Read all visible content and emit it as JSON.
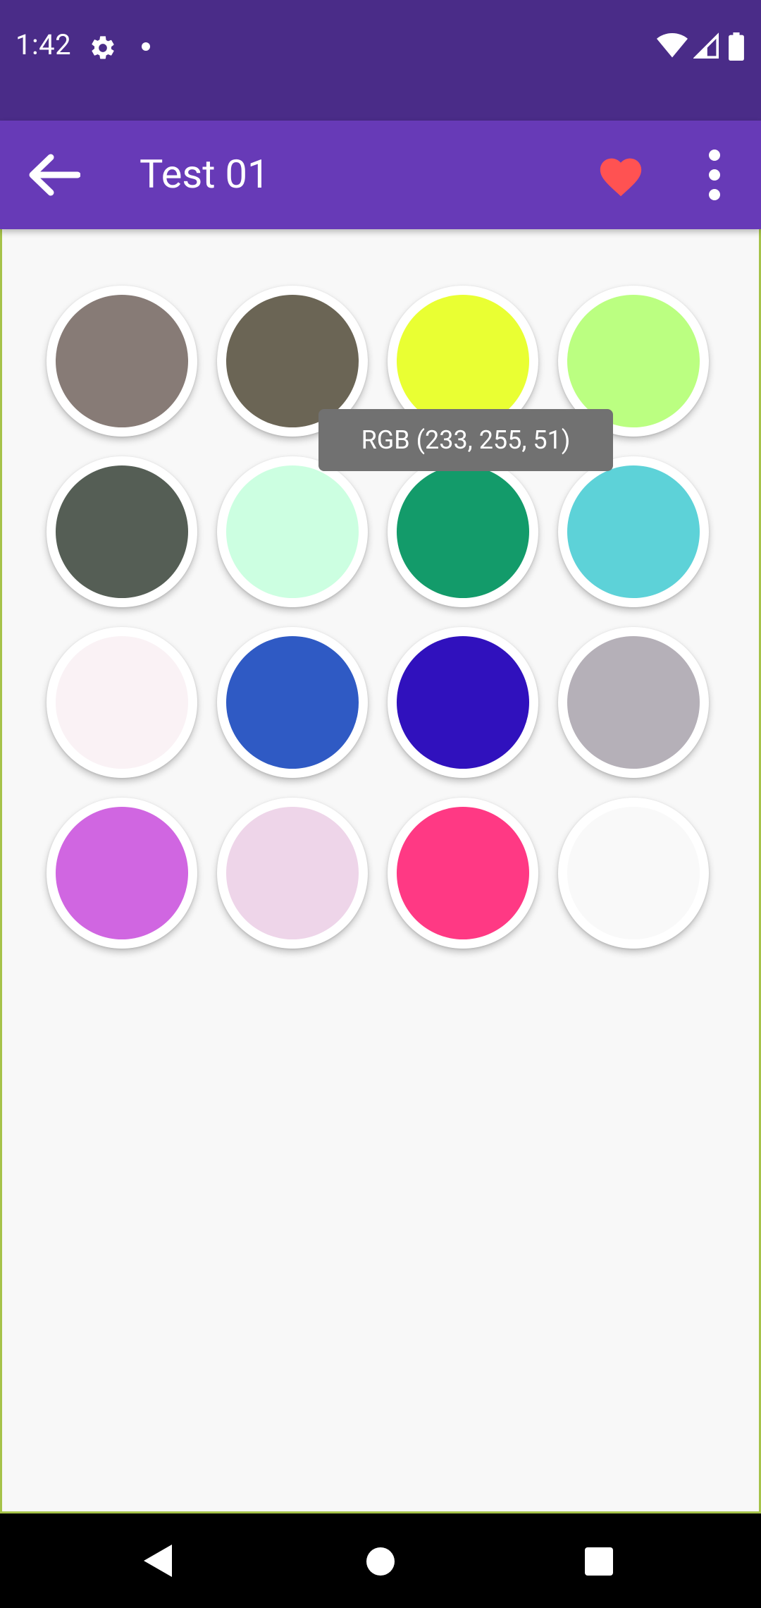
{
  "status_bar": {
    "time": "1:42",
    "icons": [
      "settings-icon",
      "notification-dot-icon",
      "wifi-icon",
      "cell-signal-icon",
      "battery-icon"
    ]
  },
  "app_bar": {
    "title": "Test 01",
    "back_icon": "arrow-back-icon",
    "favorite_icon": "heart-icon",
    "more_icon": "more-vert-icon",
    "colors": {
      "primary": "#673ab7",
      "status": "#4a2c88",
      "favorite": "#ff5252"
    }
  },
  "swatches": [
    [
      "#877b76",
      "#6b6555",
      "#e9ff33",
      "#bbff81"
    ],
    [
      "#555e55",
      "#ccffe1",
      "#139b6a",
      "#5dd2d8"
    ],
    [
      "#faf2f5",
      "#2f5ac4",
      "#3011bd",
      "#b5b0b8"
    ],
    [
      "#d066e1",
      "#eed5e9",
      "#ff3984",
      "#f9f9f9"
    ]
  ],
  "tooltip": {
    "text": "RGB (233, 255, 51)"
  },
  "nav_bar": {
    "icons": [
      "nav-back-icon",
      "nav-home-icon",
      "nav-recents-icon"
    ]
  }
}
